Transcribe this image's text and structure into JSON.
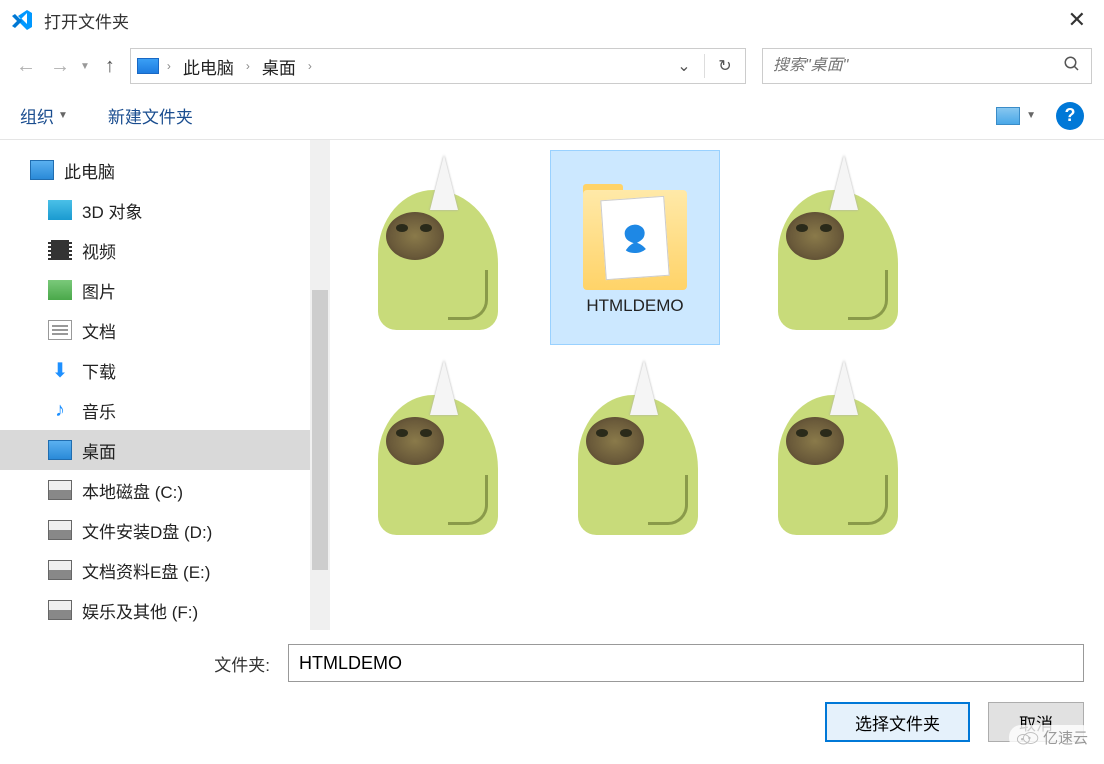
{
  "window": {
    "title": "打开文件夹"
  },
  "nav": {
    "breadcrumb": [
      "此电脑",
      "桌面"
    ],
    "search_placeholder": "搜索\"桌面\""
  },
  "toolbar": {
    "organize": "组织",
    "new_folder": "新建文件夹"
  },
  "sidebar": {
    "items": [
      {
        "label": "此电脑",
        "icon": "pc",
        "indent": false
      },
      {
        "label": "3D 对象",
        "icon": "3d",
        "indent": true
      },
      {
        "label": "视频",
        "icon": "video",
        "indent": true
      },
      {
        "label": "图片",
        "icon": "pics",
        "indent": true
      },
      {
        "label": "文档",
        "icon": "docs",
        "indent": true
      },
      {
        "label": "下载",
        "icon": "dl",
        "indent": true
      },
      {
        "label": "音乐",
        "icon": "music",
        "indent": true
      },
      {
        "label": "桌面",
        "icon": "desktop",
        "indent": true,
        "selected": true
      },
      {
        "label": "本地磁盘 (C:)",
        "icon": "drive",
        "indent": true
      },
      {
        "label": "文件安装D盘 (D:)",
        "icon": "drive",
        "indent": true
      },
      {
        "label": "文档资料E盘 (E:)",
        "icon": "drive",
        "indent": true
      },
      {
        "label": "娱乐及其他 (F:)",
        "icon": "drive",
        "indent": true
      }
    ]
  },
  "content": {
    "items": [
      {
        "type": "image",
        "selected": false
      },
      {
        "type": "folder",
        "label": "HTMLDEMO",
        "selected": true
      },
      {
        "type": "image",
        "selected": false
      },
      {
        "type": "image",
        "selected": false
      },
      {
        "type": "image",
        "selected": false
      },
      {
        "type": "image",
        "selected": false
      }
    ]
  },
  "footer": {
    "folder_label": "文件夹:",
    "folder_value": "HTMLDEMO",
    "select_btn": "选择文件夹",
    "cancel_btn": "取消"
  },
  "watermark": "亿速云"
}
